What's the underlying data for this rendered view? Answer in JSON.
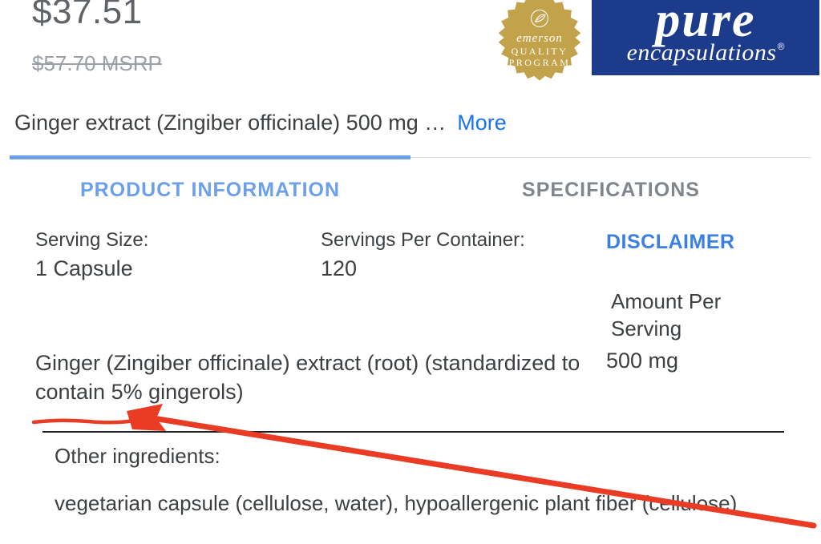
{
  "pricing": {
    "current": "$37.51",
    "msrp": "$57.70 MSRP"
  },
  "badge": {
    "line1": "emerson",
    "line2": "QUALITY",
    "line3": "PROGRAM"
  },
  "brand": {
    "main": "pure",
    "sub": "encapsulations",
    "reg": "®"
  },
  "summary": {
    "text": "Ginger extract (Zingiber officinale) 500 mg …",
    "more": "More"
  },
  "tabs": {
    "product_info": "PRODUCT INFORMATION",
    "specifications": "SPECIFICATIONS"
  },
  "info": {
    "serving_size_label": "Serving Size:",
    "serving_size_value": "1 Capsule",
    "servings_per_container_label": "Servings Per Container:",
    "servings_per_container_value": "120",
    "disclaimer": "DISCLAIMER",
    "amount_header": "Amount Per Serving",
    "ingredient_name": "Ginger (Zingiber officinale) extract (root) (standardized to contain 5% gingerols)",
    "ingredient_amount": "500 mg",
    "other_ingredients_label": "Other ingredients:",
    "other_ingredients_value": "vegetarian capsule (cellulose, water), hypoallergenic plant fiber (cellulose)"
  },
  "colors": {
    "accent_blue": "#1a73e8",
    "tab_active": "#6ca0e8",
    "brand_bg": "#1d3b8b",
    "badge_bg": "#c2a24b",
    "annotation": "#ea3b24"
  }
}
